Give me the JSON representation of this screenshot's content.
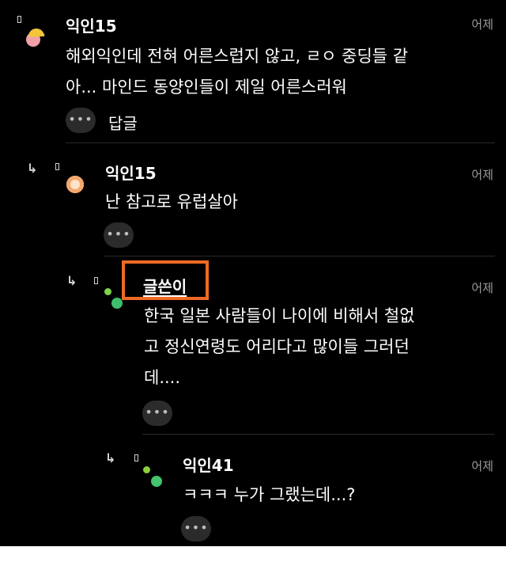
{
  "comments": [
    {
      "author": "익인15",
      "time": "어제",
      "lines": [
        "해외익인데 전혀 어른스럽지 않고, ㄹㅇ 중딩들 같",
        "아... 마인드 동양인들이 제일 어른스러워"
      ],
      "more": "•••",
      "reply_label": "답글"
    },
    {
      "author": "익인15",
      "time": "어제",
      "lines": [
        "난 참고로 유럽살아"
      ],
      "more": "•••"
    },
    {
      "author": "글쓴이",
      "time": "어제",
      "lines": [
        "한국 일본 사람들이 나이에 비해서 철없",
        "고 정신연령도 어리다고 많이들 그러던",
        "데...."
      ],
      "more": "•••"
    },
    {
      "author": "익인41",
      "time": "어제",
      "lines": [
        "ㅋㅋㅋ 누가 그랬는데...?"
      ],
      "more": "•••"
    }
  ],
  "icons": {
    "reply_arrow": "↳",
    "highlight_color": "#ee6a26",
    "avatar_colors": [
      "#f2c53a",
      "#f0a0a8",
      "#f3a86d",
      "#7fd34c",
      "#3fbf6e",
      "#8ccf3a",
      "#43c46d"
    ]
  }
}
